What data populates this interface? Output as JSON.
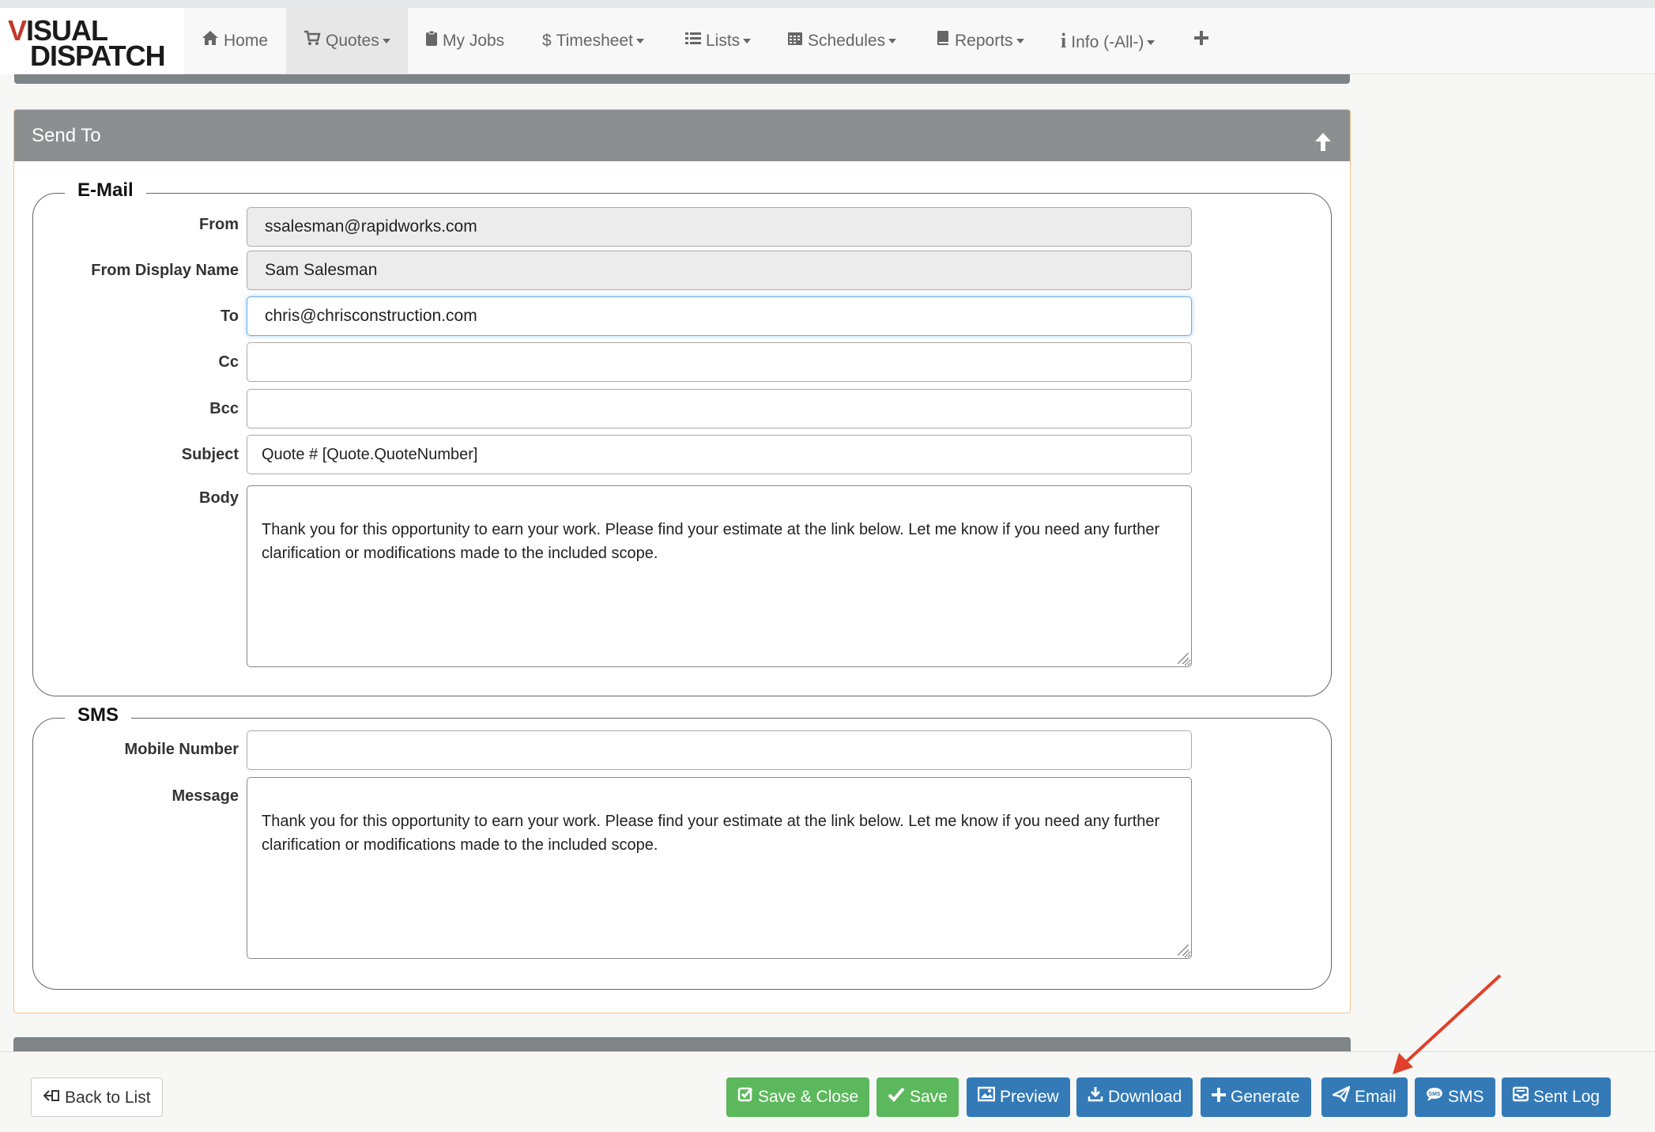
{
  "logo": {
    "line1_v": "V",
    "line1_rest": "ISUAL",
    "line2": "DISPATCH"
  },
  "nav": {
    "home": "Home",
    "quotes": "Quotes",
    "myjobs": "My Jobs",
    "timesheet": "Timesheet",
    "lists": "Lists",
    "schedules": "Schedules",
    "reports": "Reports",
    "info": "Info (-All-)"
  },
  "panel": {
    "title": "Send To"
  },
  "email": {
    "legend": "E-Mail",
    "from_label": "From",
    "from_value": "ssalesman@rapidworks.com",
    "display_label": "From Display Name",
    "display_value": "Sam Salesman",
    "to_label": "To",
    "to_value": "chris@chrisconstruction.com",
    "cc_label": "Cc",
    "cc_value": "",
    "bcc_label": "Bcc",
    "bcc_value": "",
    "subject_label": "Subject",
    "subject_value": "Quote # [Quote.QuoteNumber]",
    "body_label": "Body",
    "body_value": "Thank you for this opportunity to earn your work.  Please find your estimate at the link below.  Let me know if you need any further clarification or modifications made to the included scope."
  },
  "sms": {
    "legend": "SMS",
    "mobile_label": "Mobile Number",
    "mobile_value": "",
    "message_label": "Message",
    "message_value": "Thank you for this opportunity to earn your work.  Please find your estimate at the link below.  Let me know if you need any further clarification or modifications made to the included scope."
  },
  "footer": {
    "back": "Back to List",
    "save_close": "Save & Close",
    "save": "Save",
    "preview": "Preview",
    "download": "Download",
    "generate": "Generate",
    "email": "Email",
    "sms": "SMS",
    "sent_log": "Sent Log"
  },
  "colors": {
    "green": "#5cb85c",
    "blue": "#337ab7",
    "panel_header": "#8b8f90",
    "annotation_arrow": "#e0402a"
  }
}
